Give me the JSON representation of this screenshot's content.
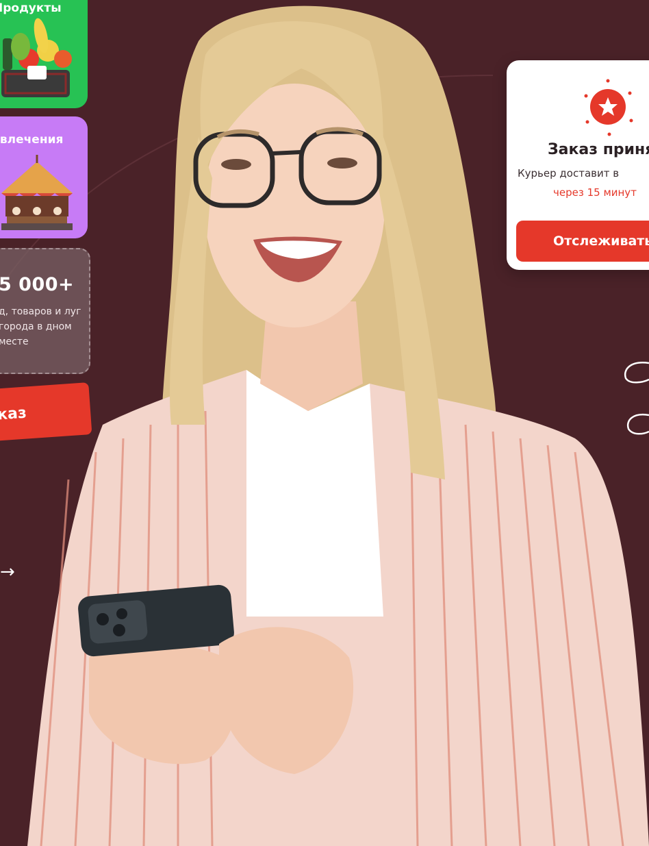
{
  "categories": [
    {
      "label": "Продукты",
      "color": "#27c254",
      "icon": "grocery-basket-icon"
    },
    {
      "label": "звлечения",
      "color": "#c77bf6",
      "icon": "carousel-icon"
    }
  ],
  "stat": {
    "value": "5 000+",
    "description": "д, товаров и луг города в дном месте"
  },
  "order_button": {
    "label": "каз"
  },
  "arrow_link": {
    "label": "→"
  },
  "notification": {
    "title": "Заказ принят",
    "text": "Курьер доставит в",
    "time": "через 15 минут",
    "button_label": "Отслеживать"
  },
  "colors": {
    "background": "#4a2228",
    "accent": "#e5382a",
    "green": "#27c254",
    "purple": "#c77bf6"
  }
}
